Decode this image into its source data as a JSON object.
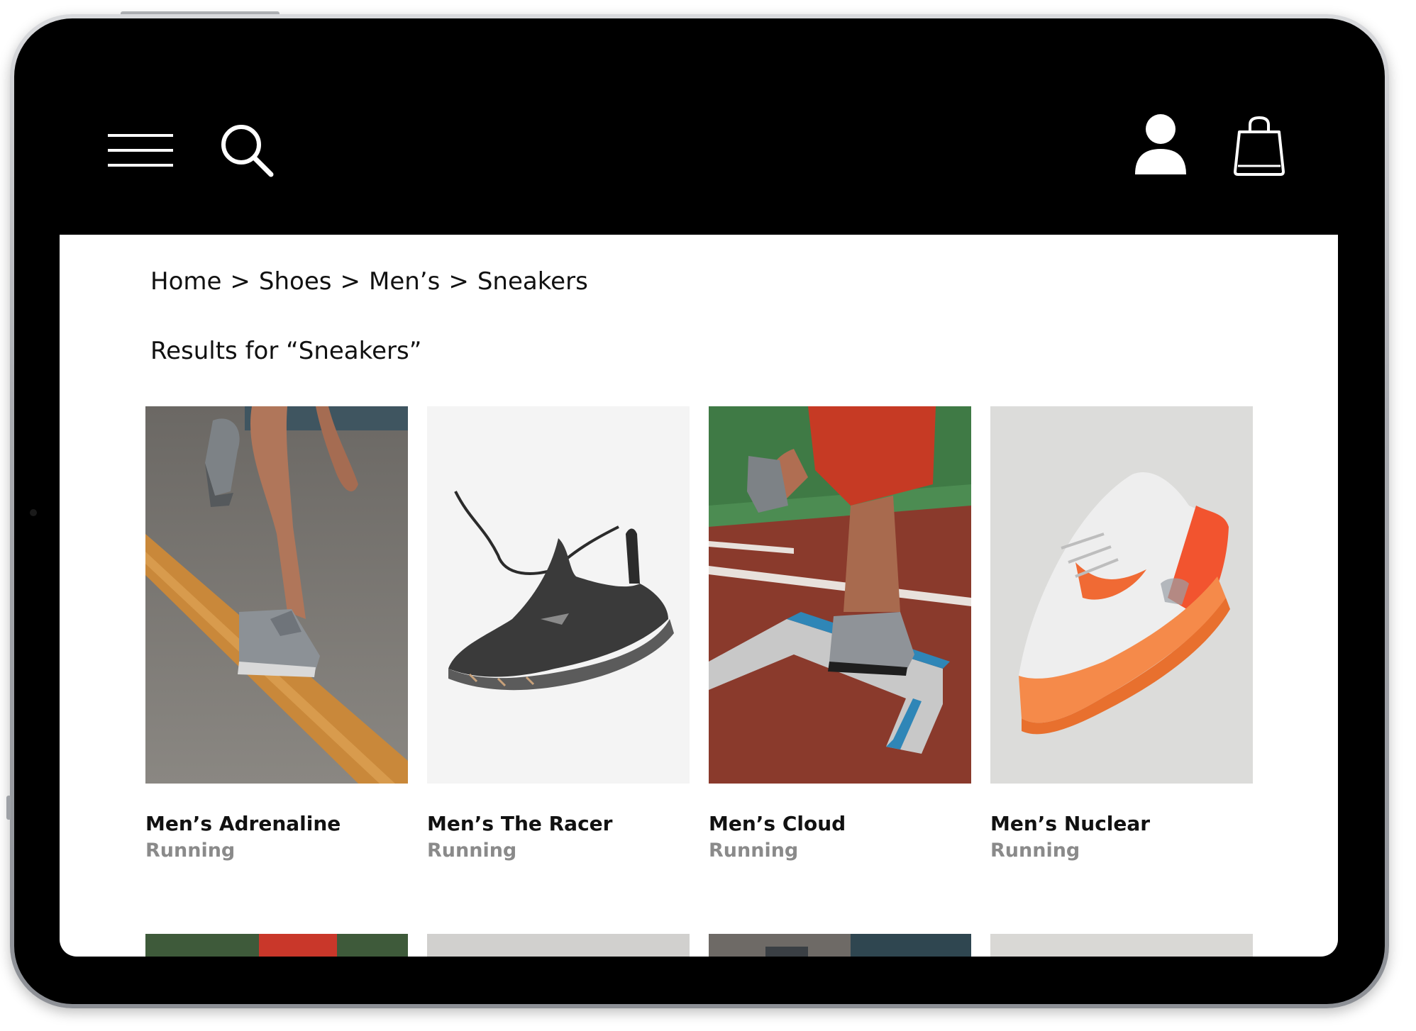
{
  "topbar": {
    "menu_icon": "hamburger-menu-icon",
    "search_icon": "search-icon",
    "account_icon": "user-account-icon",
    "bag_icon": "shopping-bag-icon"
  },
  "breadcrumb": {
    "items": [
      "Home",
      "Shoes",
      "Men’s",
      "Sneakers"
    ],
    "separator": ">"
  },
  "results": {
    "title": "Results for “Sneakers”"
  },
  "products": [
    {
      "name": "Men’s Adrenaline",
      "category": "Running"
    },
    {
      "name": "Men’s The Racer",
      "category": "Running"
    },
    {
      "name": "Men’s Cloud",
      "category": "Running"
    },
    {
      "name": "Men’s Nuclear",
      "category": "Running"
    }
  ],
  "colors": {
    "frame": "#000000",
    "screen": "#ffffff",
    "text": "#111111",
    "muted": "#8a8a8a",
    "accent_orange": "#f06a34"
  }
}
